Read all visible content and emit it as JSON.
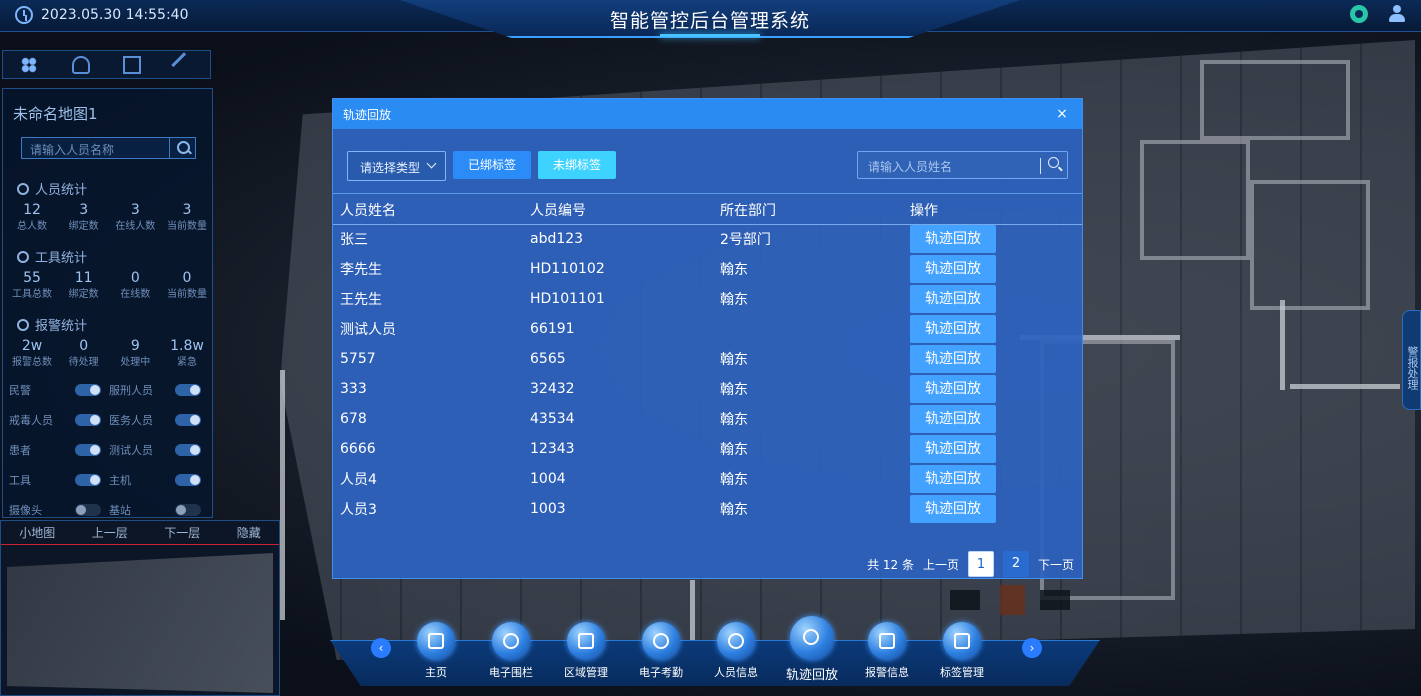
{
  "header": {
    "datetime": "2023.05.30 14:55:40",
    "title": "智能管控后台管理系统"
  },
  "left_panel": {
    "map_name": "未命名地图1",
    "search_placeholder": "请输入人员名称",
    "personnel": {
      "heading": "人员统计",
      "stats": [
        {
          "value": "12",
          "label": "总人数"
        },
        {
          "value": "3",
          "label": "绑定数"
        },
        {
          "value": "3",
          "label": "在线人数"
        },
        {
          "value": "3",
          "label": "当前数量"
        }
      ]
    },
    "tools": {
      "heading": "工具统计",
      "stats": [
        {
          "value": "55",
          "label": "工具总数"
        },
        {
          "value": "11",
          "label": "绑定数"
        },
        {
          "value": "0",
          "label": "在线数"
        },
        {
          "value": "0",
          "label": "当前数量"
        }
      ]
    },
    "alarms": {
      "heading": "报警统计",
      "stats": [
        {
          "value": "2w",
          "label": "报警总数"
        },
        {
          "value": "0",
          "label": "待处理"
        },
        {
          "value": "9",
          "label": "处理中"
        },
        {
          "value": "1.8w",
          "label": "紧急"
        }
      ]
    },
    "toggles": [
      {
        "label": "民警",
        "on": true
      },
      {
        "label": "服刑人员",
        "on": true
      },
      {
        "label": "戒毒人员",
        "on": true
      },
      {
        "label": "医务人员",
        "on": true
      },
      {
        "label": "患者",
        "on": true
      },
      {
        "label": "测试人员",
        "on": true
      },
      {
        "label": "工具",
        "on": true
      },
      {
        "label": "主机",
        "on": true
      },
      {
        "label": "摄像头",
        "on": false
      },
      {
        "label": "基站",
        "on": false
      }
    ]
  },
  "minimap": {
    "label": "小地图",
    "up": "上一层",
    "down": "下一层",
    "hide": "隐藏"
  },
  "right_tab": {
    "label": "警报处理"
  },
  "modal": {
    "title": "轨迹回放",
    "close": "×",
    "select_placeholder": "请选择类型",
    "btn_bound": "已绑标签",
    "btn_unbound": "未绑标签",
    "search_placeholder": "请输入人员姓名",
    "columns": [
      "人员姓名",
      "人员编号",
      "所在部门",
      "操作"
    ],
    "rows": [
      {
        "name": "张三",
        "id": "abd123",
        "dept": "2号部门"
      },
      {
        "name": "李先生",
        "id": "HD110102",
        "dept": "翰东"
      },
      {
        "name": "王先生",
        "id": "HD101101",
        "dept": "翰东"
      },
      {
        "name": "测试人员",
        "id": "66191",
        "dept": ""
      },
      {
        "name": "5757",
        "id": "6565",
        "dept": "翰东"
      },
      {
        "name": "333",
        "id": "32432",
        "dept": "翰东"
      },
      {
        "name": "678",
        "id": "43534",
        "dept": "翰东"
      },
      {
        "name": "6666",
        "id": "12343",
        "dept": "翰东"
      },
      {
        "name": "人员4",
        "id": "1004",
        "dept": "翰东"
      },
      {
        "name": "人员3",
        "id": "1003",
        "dept": "翰东"
      }
    ],
    "row_action": "轨迹回放",
    "pager": {
      "total": "共 12 条",
      "prev": "上一页",
      "pages": [
        "1",
        "2"
      ],
      "current": "1",
      "next": "下一页"
    }
  },
  "bottom_nav": [
    {
      "label": "主页",
      "icon": "home-icon"
    },
    {
      "label": "电子围栏",
      "icon": "fence-icon"
    },
    {
      "label": "区域管理",
      "icon": "layers-icon"
    },
    {
      "label": "电子考勤",
      "icon": "attendance-icon"
    },
    {
      "label": "人员信息",
      "icon": "person-icon"
    },
    {
      "label": "轨迹回放",
      "icon": "history-icon",
      "active": true
    },
    {
      "label": "报警信息",
      "icon": "alarm-icon"
    },
    {
      "label": "标签管理",
      "icon": "tag-icon"
    }
  ],
  "colors": {
    "modal_header": "#2a8cf2",
    "accent": "#43a2ff",
    "unbound_btn": "#3ed3ff"
  }
}
